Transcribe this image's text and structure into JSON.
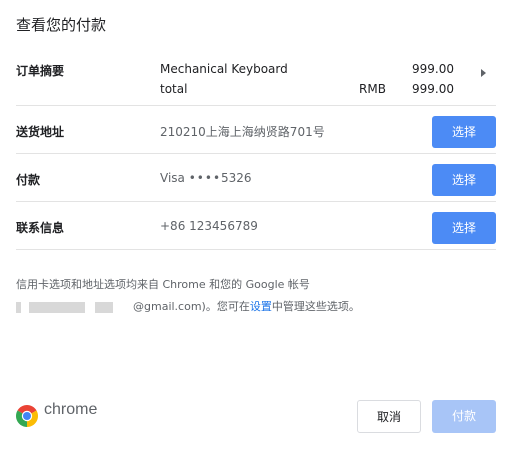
{
  "dialog": {
    "title": "查看您的付款"
  },
  "order": {
    "label": "订单摘要",
    "item_name": "Mechanical Keyboard",
    "item_price": "999.00",
    "total_label": "total",
    "currency": "RMB",
    "total_price": "999.00"
  },
  "shipping": {
    "label": "送货地址",
    "value": "210210上海上海纳贤路701号",
    "button": "选择"
  },
  "payment": {
    "label": "付款",
    "card_brand": "Visa",
    "card_dots": "••••",
    "card_last4": "5326",
    "button": "选择"
  },
  "contact": {
    "label": "联系信息",
    "value": "+86 123456789",
    "button": "选择"
  },
  "info": {
    "line1": "信用卡选项和地址选项均来自 Chrome 和您的 Google 帐号",
    "email_suffix": "@gmail.com)。您可在",
    "settings_link": "设置",
    "line2_end": "中管理这些选项。"
  },
  "footer": {
    "brand": "chrome",
    "cancel": "取消",
    "pay": "付款"
  },
  "colors": {
    "primary": "#4c8bf5",
    "primary_disabled": "#a8c5f7",
    "link": "#1a73e8"
  },
  "icons": {
    "brand": "chrome-logo-icon",
    "expand": "triangle-right-icon"
  }
}
